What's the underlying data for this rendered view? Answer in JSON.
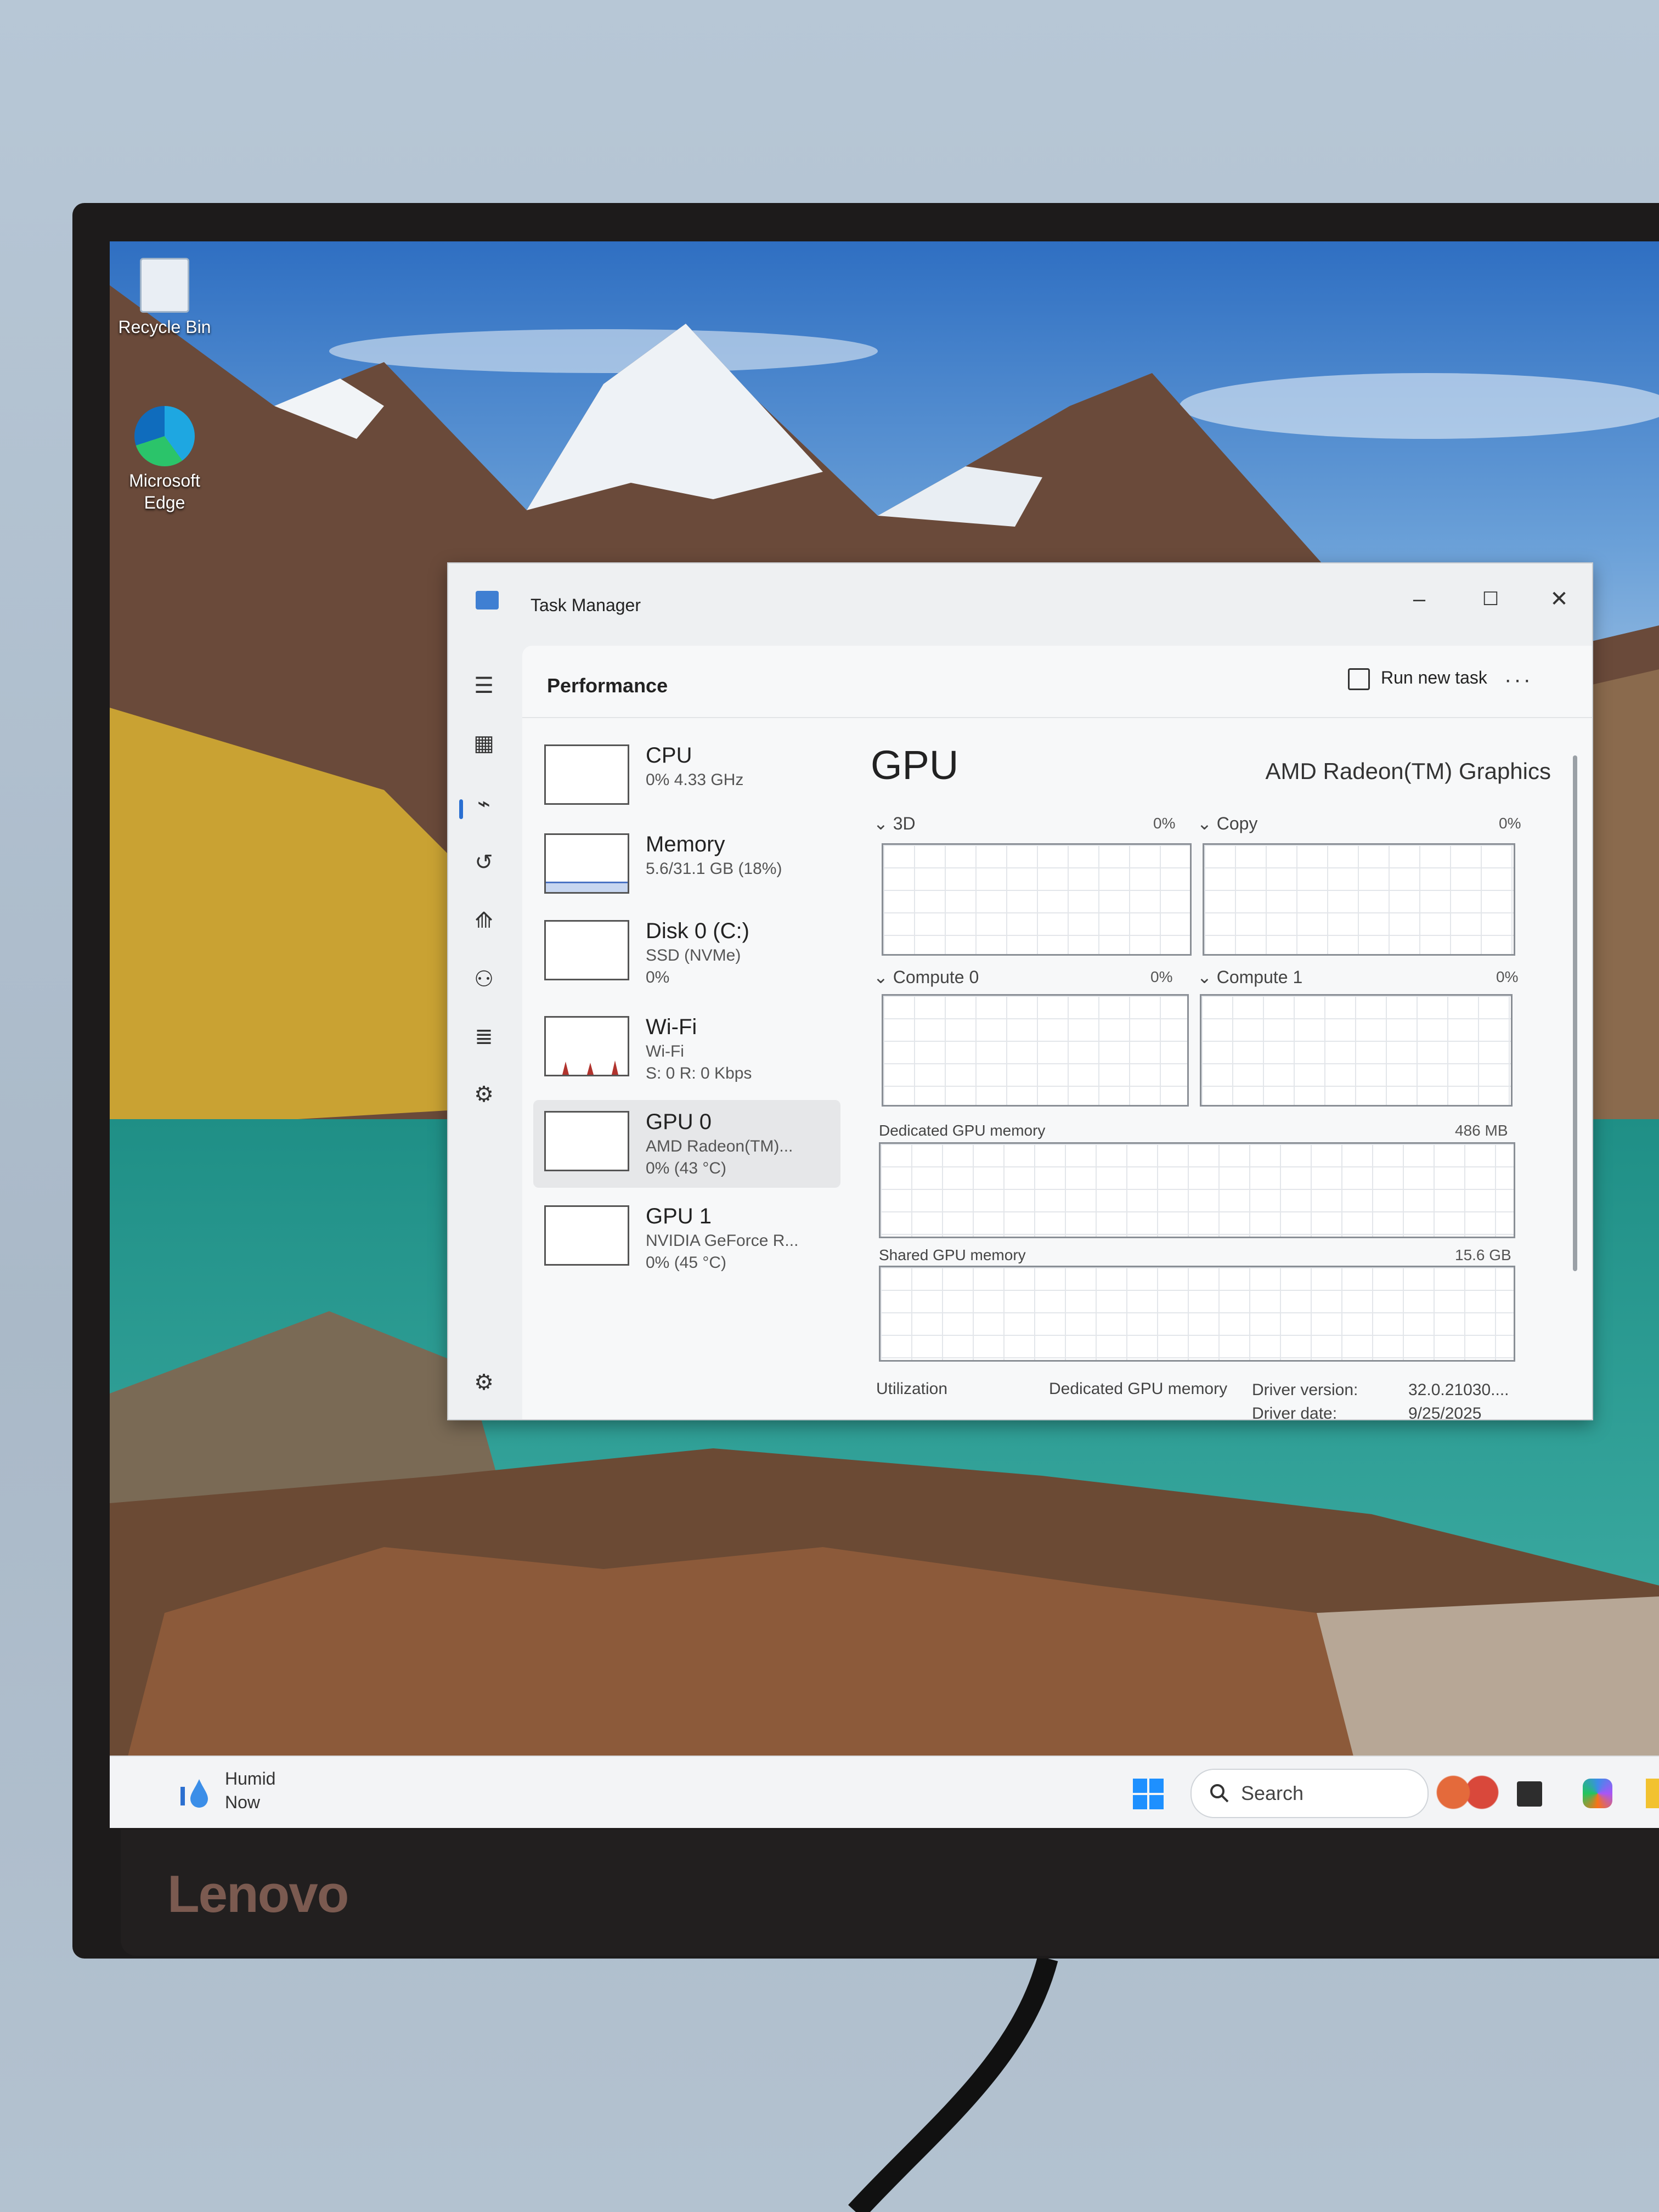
{
  "monitor": {
    "brand": "Lenovo"
  },
  "desktop": {
    "icons": [
      {
        "label": "Recycle Bin"
      },
      {
        "label": "Microsoft Edge"
      }
    ]
  },
  "task_manager": {
    "title": "Task Manager",
    "page": "Performance",
    "run_new_task": "Run new task",
    "devices": [
      {
        "name": "CPU",
        "line1": "0% 4.33 GHz",
        "line2": ""
      },
      {
        "name": "Memory",
        "line1": "5.6/31.1 GB (18%)",
        "line2": ""
      },
      {
        "name": "Disk 0 (C:)",
        "line1": "SSD (NVMe)",
        "line2": "0%"
      },
      {
        "name": "Wi-Fi",
        "line1": "Wi-Fi",
        "line2": "S: 0 R: 0 Kbps"
      },
      {
        "name": "GPU 0",
        "line1": "AMD Radeon(TM)...",
        "line2": "0% (43 °C)"
      },
      {
        "name": "GPU 1",
        "line1": "NVIDIA GeForce R...",
        "line2": "0% (45 °C)"
      }
    ],
    "memory_fill_fraction": 0.18,
    "selected_device": "GPU 0",
    "detail": {
      "heading": "GPU",
      "adapter": "AMD Radeon(TM) Graphics",
      "engines": [
        {
          "label": "3D",
          "pct": "0%"
        },
        {
          "label": "Copy",
          "pct": "0%"
        },
        {
          "label": "Compute 0",
          "pct": "0%"
        },
        {
          "label": "Compute 1",
          "pct": "0%"
        }
      ],
      "dedicated_label": "Dedicated GPU memory",
      "dedicated_max": "486 MB",
      "shared_label": "Shared GPU memory",
      "shared_max": "15.6 GB",
      "footer": {
        "utilization_label": "Utilization",
        "dedicated_label": "Dedicated GPU memory",
        "driver_version_label": "Driver version:",
        "driver_version_value": "32.0.21030....",
        "driver_date_label": "Driver date:",
        "driver_date_value": "9/25/2025"
      }
    }
  },
  "taskbar": {
    "weather_line1": "Humid",
    "weather_line2": "Now",
    "search_label": "Search"
  }
}
